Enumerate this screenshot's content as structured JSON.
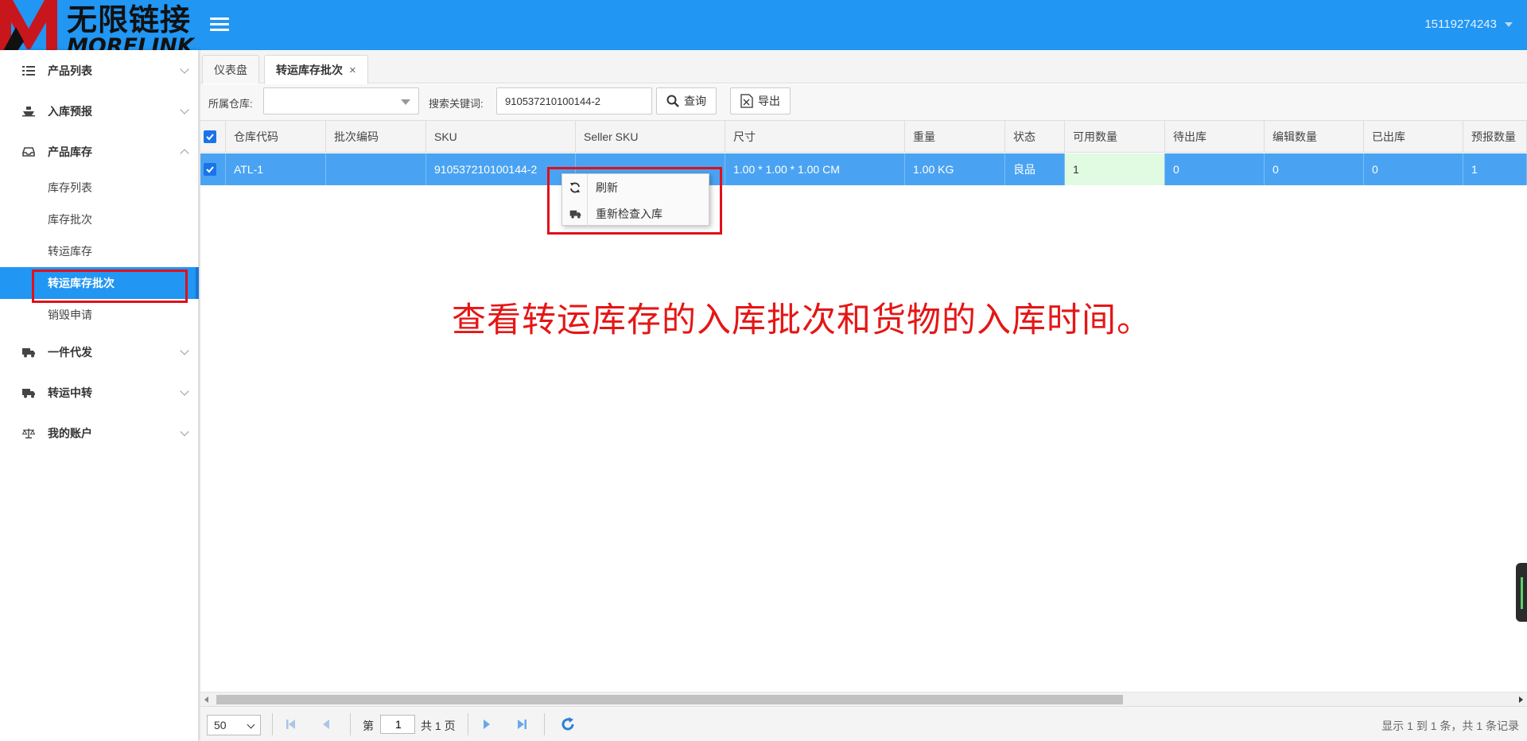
{
  "header": {
    "logo_cn": "无限链接",
    "logo_en": "MORELINK",
    "user": "15119274243"
  },
  "sidebar": {
    "groups": [
      {
        "label": "产品列表",
        "icon": "list-icon"
      },
      {
        "label": "入库预报",
        "icon": "ship-icon"
      },
      {
        "label": "产品库存",
        "icon": "inbox-icon"
      },
      {
        "label": "一件代发",
        "icon": "truck-icon"
      },
      {
        "label": "转运中转",
        "icon": "truck-icon"
      },
      {
        "label": "我的账户",
        "icon": "balance-icon"
      }
    ],
    "sub_items": [
      "库存列表",
      "库存批次",
      "转运库存",
      "转运库存批次",
      "销毁申请"
    ],
    "active_sub": "转运库存批次"
  },
  "tabs": [
    {
      "label": "仪表盘"
    },
    {
      "label": "转运库存批次",
      "close": "×"
    }
  ],
  "toolbar": {
    "warehouse_label": "所属仓库:",
    "keyword_label": "搜索关键词:",
    "keyword_value": "910537210100144-2",
    "query_label": "查询",
    "export_label": "导出"
  },
  "table": {
    "columns": [
      "仓库代码",
      "批次编码",
      "SKU",
      "Seller SKU",
      "尺寸",
      "重量",
      "状态",
      "可用数量",
      "待出库",
      "编辑数量",
      "已出库",
      "预报数量"
    ],
    "rows": [
      [
        "ATL-1",
        "",
        "910537210100144-2",
        "",
        "1.00 * 1.00 * 1.00 CM",
        "1.00 KG",
        "良品",
        "1",
        "0",
        "0",
        "0",
        "1"
      ]
    ]
  },
  "context_menu": {
    "items": [
      {
        "label": "刷新",
        "icon": "refresh-icon"
      },
      {
        "label": "重新检查入库",
        "icon": "truck-icon"
      }
    ]
  },
  "annotation": "查看转运库存的入库批次和货物的入库时间。",
  "pager": {
    "page_size": "50",
    "page_prefix": "第",
    "page": "1",
    "page_suffix": "共 1 页",
    "info": "显示 1 到 1 条，共 1 条记录"
  },
  "colors": {
    "header": "#2196f3",
    "row_selected": "#4aa3f2",
    "highlight": "#e0101a",
    "annotation": "#e51616"
  }
}
